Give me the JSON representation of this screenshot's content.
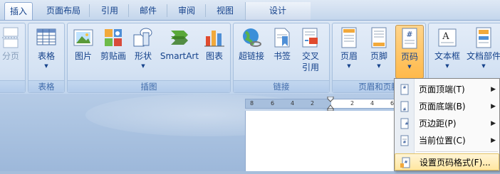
{
  "tabs": [
    {
      "label": "插入"
    },
    {
      "label": "页面布局"
    },
    {
      "label": "引用"
    },
    {
      "label": "邮件"
    },
    {
      "label": "审阅"
    },
    {
      "label": "视图"
    },
    {
      "label": "设计"
    }
  ],
  "groups": {
    "pages": {
      "label": "",
      "buttons": [
        {
          "label": "分页"
        }
      ]
    },
    "table": {
      "label": "表格",
      "buttons": [
        {
          "label": "表格"
        }
      ]
    },
    "illustrations": {
      "label": "插图",
      "buttons": [
        {
          "label": "图片"
        },
        {
          "label": "剪贴画"
        },
        {
          "label": "形状"
        },
        {
          "label": "SmartArt"
        },
        {
          "label": "图表"
        }
      ]
    },
    "links": {
      "label": "链接",
      "buttons": [
        {
          "label": "超链接"
        },
        {
          "label": "书签"
        },
        {
          "label": "交叉\n引用",
          "line1": "交叉",
          "line2": "引用"
        }
      ]
    },
    "header_footer": {
      "label": "页眉和页脚",
      "buttons": [
        {
          "label": "页眉"
        },
        {
          "label": "页脚"
        },
        {
          "label": "页码"
        }
      ]
    },
    "text": {
      "label": "",
      "buttons": [
        {
          "label": "文本框"
        },
        {
          "label": "文档部件"
        }
      ]
    }
  },
  "ruler": {
    "ticks": [
      "8",
      "6",
      "4",
      "2",
      "2",
      "4",
      "6"
    ]
  },
  "page_number_menu": {
    "items": [
      {
        "label": "页面顶端(T)",
        "has_submenu": true
      },
      {
        "label": "页面底端(B)",
        "has_submenu": true
      },
      {
        "label": "页边距(P)",
        "has_submenu": true
      },
      {
        "label": "当前位置(C)",
        "has_submenu": true
      },
      {
        "label": "设置页码格式(F)...",
        "has_submenu": false
      }
    ]
  },
  "colors": {
    "ribbon_text": "#15428b",
    "group_label": "#3e6aaa",
    "pressed_button": "#ffb94a",
    "menu_hover": "#ffe6a0"
  }
}
